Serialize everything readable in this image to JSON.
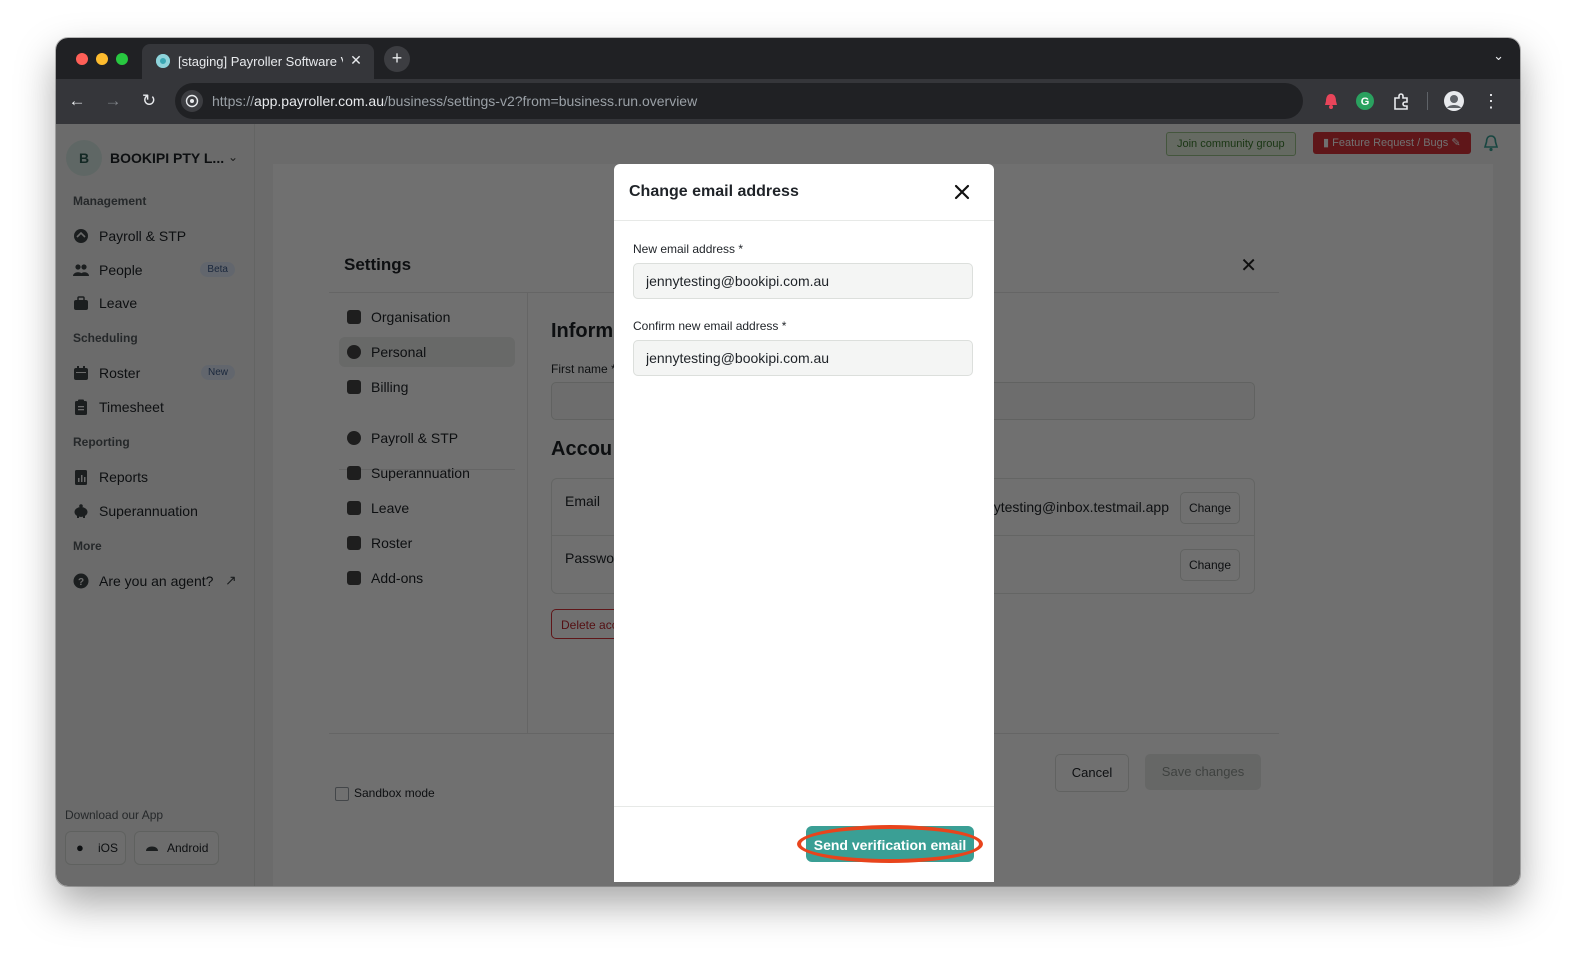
{
  "browser": {
    "tab_title": "[staging] Payroller Software V",
    "url_prefix": "https://",
    "url_host": "app.payroller.com.au",
    "url_path": "/business/settings-v2?from=business.run.overview"
  },
  "sidebar": {
    "org_initial": "B",
    "org_name": "BOOKIPI PTY L...",
    "sections": {
      "management": "Management",
      "scheduling": "Scheduling",
      "reporting": "Reporting",
      "more": "More"
    },
    "items": {
      "payroll": "Payroll & STP",
      "people": "People",
      "people_badge": "Beta",
      "leave": "Leave",
      "roster": "Roster",
      "roster_badge": "New",
      "timesheet": "Timesheet",
      "reports": "Reports",
      "superannuation": "Superannuation",
      "agent": "Are you an agent?"
    },
    "download_label": "Download our App",
    "ios": "iOS",
    "android": "Android"
  },
  "header": {
    "join_community": "Join community group",
    "feature_request": "Feature Request / Bugs"
  },
  "settings": {
    "title": "Settings",
    "nav": {
      "organisation": "Organisation",
      "personal": "Personal",
      "billing": "Billing",
      "payroll": "Payroll & STP",
      "superannuation": "Superannuation",
      "leave": "Leave",
      "roster": "Roster",
      "addons": "Add-ons"
    },
    "section_information": "Inform",
    "first_name_label": "First name *",
    "section_account": "Accou",
    "email_label": "Email",
    "email_value": "nytesting@inbox.testmail.app",
    "password_label": "Passwor",
    "change_label": "Change",
    "delete_label": "Delete acc",
    "sandbox_label": "Sandbox mode",
    "cancel_label": "Cancel",
    "save_label": "Save changes"
  },
  "dialog": {
    "title": "Change email address",
    "new_email_label": "New email address *",
    "new_email_value": "jennytesting@bookipi.com.au",
    "confirm_email_label": "Confirm new email address *",
    "confirm_email_value": "jennytesting@bookipi.com.au",
    "send_button": "Send verification email"
  },
  "colors": {
    "accent": "#3a9f95",
    "highlight": "#e8441c",
    "danger": "#d8343a"
  }
}
